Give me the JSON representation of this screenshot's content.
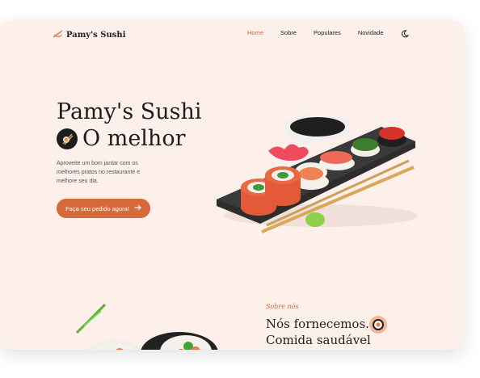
{
  "brand": {
    "name": "Pamy's Sushi"
  },
  "nav": {
    "items": [
      {
        "label": "Home",
        "active": true
      },
      {
        "label": "Sobre",
        "active": false
      },
      {
        "label": "Populares",
        "active": false
      },
      {
        "label": "Novidade",
        "active": false
      }
    ],
    "theme_icon": "moon-icon"
  },
  "hero": {
    "title_line1": "Pamy's Sushi",
    "title_line2": "O melhor",
    "description": "Aproveite um bom jantar com os melhores pratos no restaurante e melhore seu dia.",
    "cta_label": "Faça seu pedido agora!"
  },
  "about": {
    "subtitle": "Sobre nós",
    "title_line1": "Nós fornecemos.",
    "title_line2": "Comida saudável"
  },
  "colors": {
    "accent": "#d7683a",
    "background": "#fdf0eb",
    "text": "#1d1d1d"
  }
}
